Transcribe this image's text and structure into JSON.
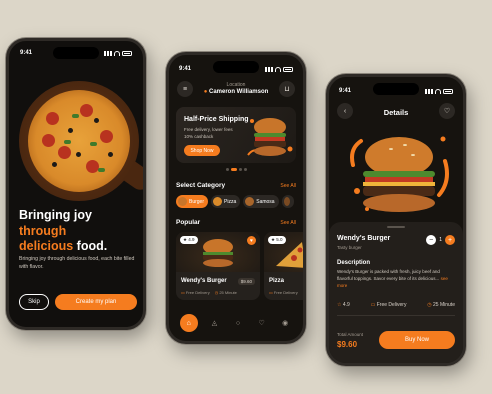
{
  "colors": {
    "accent": "#f57c1f",
    "background": "#dcd6c8",
    "screen": "#16130f"
  },
  "onboarding": {
    "time": "9:41",
    "headline_line1": "Bringing joy",
    "headline_line2": "through",
    "headline_line3a": "delicious",
    "headline_line3b": "food.",
    "body": "Bringing joy through delicious food, each bite filled with flavor.",
    "skip_label": "Skip",
    "create_plan_label": "Create my plan"
  },
  "home": {
    "time": "9:41",
    "location_label": "Location",
    "location_name": "Cameron Williamson",
    "promo": {
      "title": "Half-Price Shipping",
      "line1": "Free delivery, lower fees",
      "line2": "10% cashback",
      "button": "Shop Now"
    },
    "select_category": "Select Category",
    "see_all_1": "See All",
    "categories": [
      {
        "label": "Burger",
        "icon": "burger-icon"
      },
      {
        "label": "Pizza",
        "icon": "pizza-icon"
      },
      {
        "label": "Samosa",
        "icon": "samosa-icon"
      }
    ],
    "popular": "Popular",
    "see_all_2": "See All",
    "cards": [
      {
        "rating": "★ 4.9",
        "name": "Wendy's Burger",
        "price": "$9.60",
        "delivery": "Free Delivery",
        "time": "25 Minute"
      },
      {
        "rating": "★ 5.0",
        "name": "Pizza",
        "price": "",
        "delivery": "Free Delivery",
        "time": ""
      }
    ],
    "nav": [
      "home-icon",
      "bell-icon",
      "search-icon",
      "heart-icon",
      "profile-icon"
    ]
  },
  "details": {
    "time": "9:41",
    "title": "Details",
    "name": "Wendy's Burger",
    "subtitle": "Tasty burger",
    "quantity": "1",
    "description_heading": "Description",
    "description": "Wendy's Burger is packed with fresh, juicy beef and flavorful toppings. Savor every bite of its delicious...",
    "see_more": " see more",
    "rating": "4.9",
    "delivery": "Free Delivery",
    "time_est": "25 Minute",
    "total_label": "Total Amount",
    "total_value": "$9.60",
    "buy_label": "Buy Now"
  }
}
